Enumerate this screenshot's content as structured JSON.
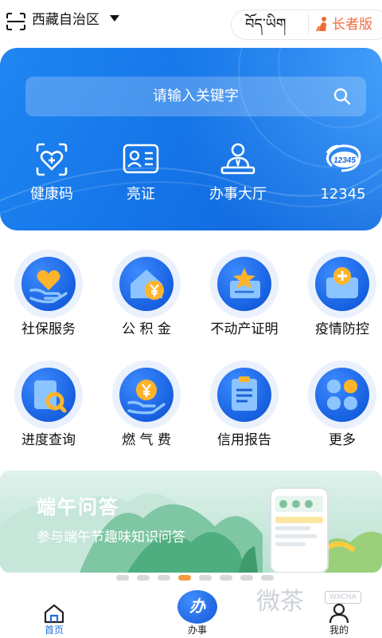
{
  "topbar": {
    "region": "西藏自治区",
    "tibetan_label": "བོད་ཡིག",
    "elder_mode_label": "长者版",
    "accent_color": "#f06a3a"
  },
  "hero": {
    "search_placeholder": "请输入关键字",
    "quick_actions": [
      {
        "label": "健康码",
        "icon": "health-code-heart-icon"
      },
      {
        "label": "亮证",
        "icon": "id-card-icon"
      },
      {
        "label": "办事大厅",
        "icon": "service-hall-icon"
      },
      {
        "label": "12345",
        "icon": "hotline-12345-icon"
      }
    ],
    "hotline_badge": "12345"
  },
  "services": [
    {
      "label": "社保服务",
      "icon": "social-security-heart-hand-icon"
    },
    {
      "label": "公 积 金",
      "icon": "housing-fund-yen-icon"
    },
    {
      "label": "不动产证明",
      "icon": "real-estate-star-icon"
    },
    {
      "label": "疫情防控",
      "icon": "epidemic-shield-plus-icon"
    },
    {
      "label": "进度查询",
      "icon": "progress-search-icon"
    },
    {
      "label": "燃 气 费",
      "icon": "gas-fee-yen-hand-icon"
    },
    {
      "label": "信用报告",
      "icon": "credit-report-document-icon"
    },
    {
      "label": "更多",
      "icon": "more-petals-icon"
    }
  ],
  "banner": {
    "title": "端午问答",
    "subtitle": "参与端午节趣味知识问答"
  },
  "pager": {
    "count": 8,
    "active_index": 3
  },
  "bottom_nav": {
    "items": [
      {
        "label": "首页",
        "icon": "home-icon"
      },
      {
        "label": "办事",
        "icon": "work-icon",
        "badge_text": "办"
      },
      {
        "label": "我的",
        "icon": "profile-icon"
      }
    ],
    "active_color": "#1e6fe6"
  },
  "watermark": {
    "text": "微茶",
    "tag": "WXCHA"
  }
}
